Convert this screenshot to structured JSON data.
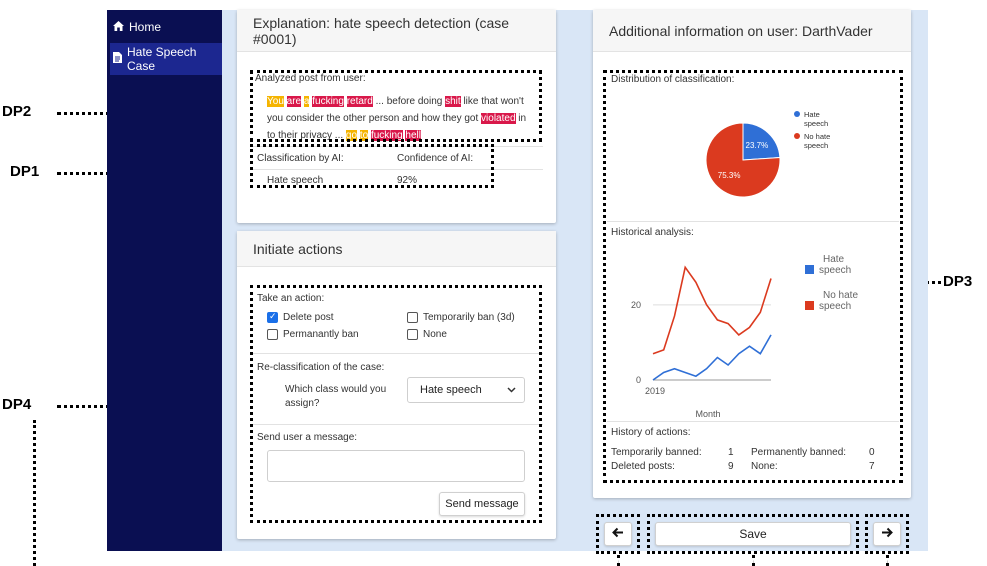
{
  "annotations": {
    "dp1": "DP1",
    "dp2": "DP2",
    "dp3": "DP3",
    "dp4": "DP4"
  },
  "sidebar": {
    "items": [
      {
        "label": "Home",
        "icon": "home-icon"
      },
      {
        "label": "Hate Speech Case",
        "icon": "document-icon"
      }
    ]
  },
  "explanation": {
    "title": "Explanation: hate speech detection (case #0001)",
    "post_label": "Analyzed post from user:",
    "post_tokens": [
      {
        "t": "You",
        "hl": "y"
      },
      {
        "t": " ",
        "hl": ""
      },
      {
        "t": "are",
        "hl": "r"
      },
      {
        "t": " ",
        "hl": ""
      },
      {
        "t": "a",
        "hl": "y"
      },
      {
        "t": " ",
        "hl": ""
      },
      {
        "t": "fucking",
        "hl": "r"
      },
      {
        "t": " ",
        "hl": ""
      },
      {
        "t": "retard",
        "hl": "r"
      },
      {
        "t": " ... before doing ",
        "hl": ""
      },
      {
        "t": "shit",
        "hl": "r"
      },
      {
        "t": " like that won't you consider the other person and how they got ",
        "hl": ""
      },
      {
        "t": "violated",
        "hl": "r"
      },
      {
        "t": " in to their privacy ... ",
        "hl": ""
      },
      {
        "t": "go",
        "hl": "y"
      },
      {
        "t": " ",
        "hl": ""
      },
      {
        "t": "to",
        "hl": "y"
      },
      {
        "t": " ",
        "hl": ""
      },
      {
        "t": "fucking",
        "hl": "r"
      },
      {
        "t": " ",
        "hl": ""
      },
      {
        "t": "hell",
        "hl": "r"
      }
    ],
    "classification_header": "Classification by AI:",
    "confidence_header": "Confidence of AI:",
    "classification_value": "Hate speech",
    "confidence_value": "92%"
  },
  "actions": {
    "title": "Initiate actions",
    "take_action_label": "Take an action:",
    "options": [
      {
        "label": "Delete post",
        "checked": true
      },
      {
        "label": "Temporarily ban (3d)",
        "checked": false
      },
      {
        "label": "Permanantly ban",
        "checked": false
      },
      {
        "label": "None",
        "checked": false
      }
    ],
    "reclass_label": "Re-classification of the case:",
    "reclass_question": "Which class would you assign?",
    "reclass_selected": "Hate speech",
    "message_label": "Send user a message:",
    "message_value": "",
    "send_button": "Send message"
  },
  "userinfo": {
    "title": "Additional information on user: DarthVader",
    "distribution_label": "Distribution of classification:",
    "historical_label": "Historical analysis:",
    "history_label": "History of actions:",
    "history": {
      "temporarily_banned_label": "Temporarily banned:",
      "temporarily_banned_value": "1",
      "permanently_banned_label": "Permanently banned:",
      "permanently_banned_value": "0",
      "deleted_posts_label": "Deleted posts:",
      "deleted_posts_value": "9",
      "none_label": "None:",
      "none_value": "7"
    }
  },
  "footer": {
    "prev_icon": "arrow-left-icon",
    "save_label": "Save",
    "next_icon": "arrow-right-icon"
  },
  "colors": {
    "sidebar": "#0a0f52",
    "hate": "#2f6fd6",
    "no_hate": "#db3a1f",
    "highlight_yellow": "#f5b400",
    "highlight_red": "#d9184a"
  },
  "chart_data": [
    {
      "type": "pie",
      "title": "Distribution of classification:",
      "categories": [
        "Hate speech",
        "No hate speech"
      ],
      "values": [
        23.7,
        75.3
      ],
      "value_labels": [
        "23.7%",
        "75.3%"
      ],
      "legend": "right"
    },
    {
      "type": "line",
      "title": "Historical analysis:",
      "xlabel": "Month",
      "x_tick_labels": [
        "2019"
      ],
      "y_ticks": [
        "0",
        "20"
      ],
      "ylim": [
        0,
        33
      ],
      "grid": true,
      "legend": "right",
      "series": [
        {
          "name": "Hate speech",
          "values": [
            0,
            2,
            3,
            2,
            1,
            3,
            6,
            4,
            7,
            9,
            7,
            12
          ]
        },
        {
          "name": "No hate speech",
          "values": [
            7,
            8,
            17,
            30,
            26,
            20,
            16,
            15,
            12,
            14,
            18,
            27
          ]
        }
      ]
    }
  ]
}
